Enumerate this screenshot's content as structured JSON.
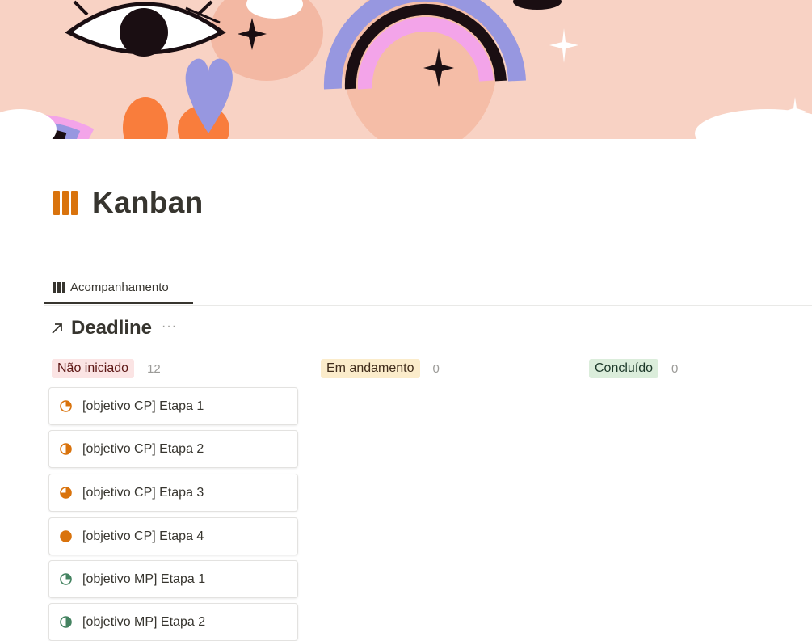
{
  "page": {
    "title": "Kanban",
    "title_icon": "columns-icon"
  },
  "views": [
    {
      "label": "Acompanhamento",
      "icon": "board-icon",
      "active": true
    }
  ],
  "database": {
    "title": "Deadline",
    "link_icon": "arrow-up-right-icon",
    "more_icon": "more-icon"
  },
  "columns": [
    {
      "label": "Não iniciado",
      "count": "12",
      "bg": "#fbe4e4",
      "fg": "#5d1715"
    },
    {
      "label": "Em andamento",
      "count": "0",
      "bg": "#fbeccb",
      "fg": "#402c1b"
    },
    {
      "label": "Concluído",
      "count": "0",
      "bg": "#dbeddb",
      "fg": "#1c3829"
    }
  ],
  "cards": [
    {
      "title": "[objetivo CP] Etapa 1",
      "progress": 0.25,
      "color": "#d9730d"
    },
    {
      "title": "[objetivo CP] Etapa 2",
      "progress": 0.5,
      "color": "#d9730d"
    },
    {
      "title": "[objetivo CP] Etapa 3",
      "progress": 0.75,
      "color": "#d9730d"
    },
    {
      "title": "[objetivo CP] Etapa 4",
      "progress": 1.0,
      "color": "#d9730d"
    },
    {
      "title": "[objetivo MP] Etapa 1",
      "progress": 0.25,
      "color": "#448361"
    },
    {
      "title": "[objetivo MP] Etapa 2",
      "progress": 0.5,
      "color": "#448361"
    }
  ]
}
